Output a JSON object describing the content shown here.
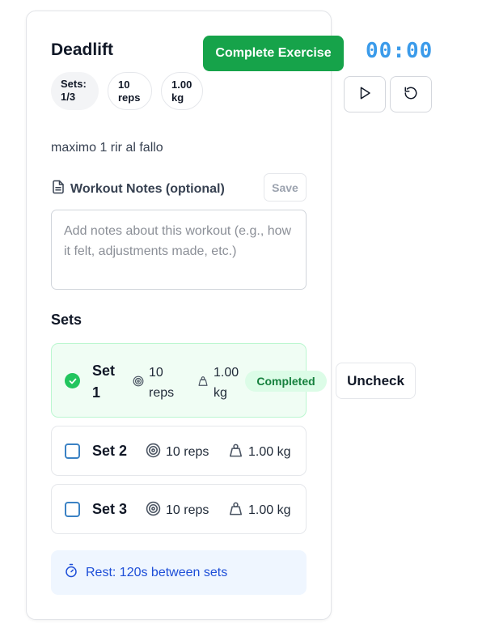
{
  "exercise": {
    "title": "Deadlift",
    "description": "maximo 1 rir al fallo",
    "complete_label": "Complete Exercise",
    "pills": {
      "sets_line1": "Sets:",
      "sets_line2": "1/3",
      "reps_line1": "10",
      "reps_line2": "reps",
      "weight_line1": "1.00",
      "weight_line2": "kg"
    }
  },
  "timer": {
    "display": "00:00",
    "play_icon": "play-icon",
    "reset_icon": "reset-icon"
  },
  "notes": {
    "title": "Workout Notes (optional)",
    "icon": "document-icon",
    "save_label": "Save",
    "placeholder": "Add notes about this workout (e.g., how it felt, adjustments made, etc.)",
    "value": ""
  },
  "sets": {
    "heading": "Sets",
    "items": [
      {
        "label": "Set 1",
        "reps": "10 reps",
        "weight": "1.00 kg",
        "completed": true,
        "status": "Completed",
        "action": "Uncheck"
      },
      {
        "label": "Set 2",
        "reps": "10 reps",
        "weight": "1.00 kg",
        "completed": false
      },
      {
        "label": "Set 3",
        "reps": "10 reps",
        "weight": "1.00 kg",
        "completed": false
      }
    ]
  },
  "rest": {
    "text": "Rest: 120s between sets",
    "icon": "stopwatch-icon"
  },
  "colors": {
    "primary_green": "#16a34a",
    "timer_blue": "#3b9bea",
    "completed_bg": "#f0fdf4",
    "rest_bg": "#eff6ff",
    "rest_text": "#1d4ed8"
  }
}
